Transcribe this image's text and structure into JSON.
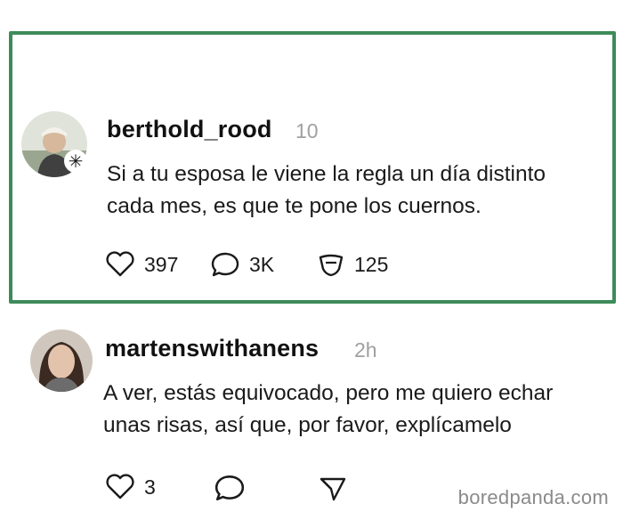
{
  "posts": [
    {
      "username": "berthold_rood",
      "timestamp": "10",
      "text_lines": [
        "Si a tu esposa le viene la regla un día distinto",
        "cada mes, es que te pone los cuernos."
      ],
      "likes": "397",
      "replies": "3K",
      "reposts": "125"
    },
    {
      "username": "martenswithanens",
      "timestamp": "2h",
      "text_lines": [
        "A ver, estás equivocado, pero me quiero echar",
        "unas risas, así que, por favor, explícamelo"
      ],
      "likes": "3"
    }
  ],
  "watermark": "boredpanda.com",
  "colors": {
    "highlight_border": "#3d8b5a",
    "timestamp": "#a0a0a0"
  },
  "icons": [
    "heart-icon",
    "comment-icon",
    "repost-icon",
    "share-icon",
    "badge-icon"
  ]
}
